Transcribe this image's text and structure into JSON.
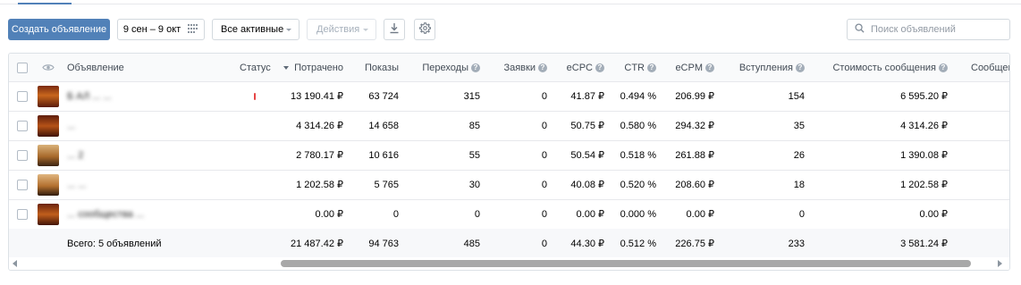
{
  "toolbar": {
    "create_label": "Создать объявление",
    "date_range": "9 сен – 9 окт",
    "filter_label": "Все активные",
    "actions_label": "Действия",
    "search_placeholder": "Поиск объявлений"
  },
  "table": {
    "headers": {
      "ad": "Объявление",
      "status": "Статус",
      "spent": "Потрачено",
      "impressions": "Показы",
      "clicks": "Переходы",
      "applications": "Заявки",
      "ecpc": "eCPC",
      "ctr": "CTR",
      "ecpm": "eCPM",
      "joins": "Вступления",
      "msg_cost": "Стоимость сообщения",
      "messages": "Сообщен"
    },
    "rows": [
      {
        "title": "Б АЛ ... ...",
        "spent": "13 190.41 ₽",
        "impressions": "63 724",
        "clicks": "315",
        "applications": "0",
        "ecpc": "41.87 ₽",
        "ctr": "0.494 %",
        "ecpm": "206.99 ₽",
        "joins": "154",
        "msg_cost": "6 595.20 ₽"
      },
      {
        "title": "...",
        "spent": "4 314.26 ₽",
        "impressions": "14 658",
        "clicks": "85",
        "applications": "0",
        "ecpc": "50.75 ₽",
        "ctr": "0.580 %",
        "ecpm": "294.32 ₽",
        "joins": "35",
        "msg_cost": "4 314.26 ₽"
      },
      {
        "title": "... 2",
        "spent": "2 780.17 ₽",
        "impressions": "10 616",
        "clicks": "55",
        "applications": "0",
        "ecpc": "50.54 ₽",
        "ctr": "0.518 %",
        "ecpm": "261.88 ₽",
        "joins": "26",
        "msg_cost": "1 390.08 ₽"
      },
      {
        "title": "... ...",
        "spent": "1 202.58 ₽",
        "impressions": "5 765",
        "clicks": "30",
        "applications": "0",
        "ecpc": "40.08 ₽",
        "ctr": "0.520 %",
        "ecpm": "208.60 ₽",
        "joins": "18",
        "msg_cost": "1 202.58 ₽"
      },
      {
        "title": "... сообщества ...",
        "spent": "0.00 ₽",
        "impressions": "0",
        "clicks": "0",
        "applications": "0",
        "ecpc": "0.00 ₽",
        "ctr": "0.000 %",
        "ecpm": "0.00 ₽",
        "joins": "0",
        "msg_cost": "0.00 ₽"
      }
    ],
    "total": {
      "label": "Всего: 5 объявлений",
      "spent": "21 487.42 ₽",
      "impressions": "94 763",
      "clicks": "485",
      "applications": "0",
      "ecpc": "44.30 ₽",
      "ctr": "0.512 %",
      "ecpm": "226.75 ₽",
      "joins": "233",
      "msg_cost": "3 581.24 ₽"
    }
  },
  "colors": {
    "primary": "#5181b8",
    "status_red": "#e64646"
  },
  "icons": [
    "calendar-grid-icon",
    "download-icon",
    "gear-icon",
    "search-icon",
    "eye-icon",
    "question-icon",
    "sort-down-icon"
  ]
}
